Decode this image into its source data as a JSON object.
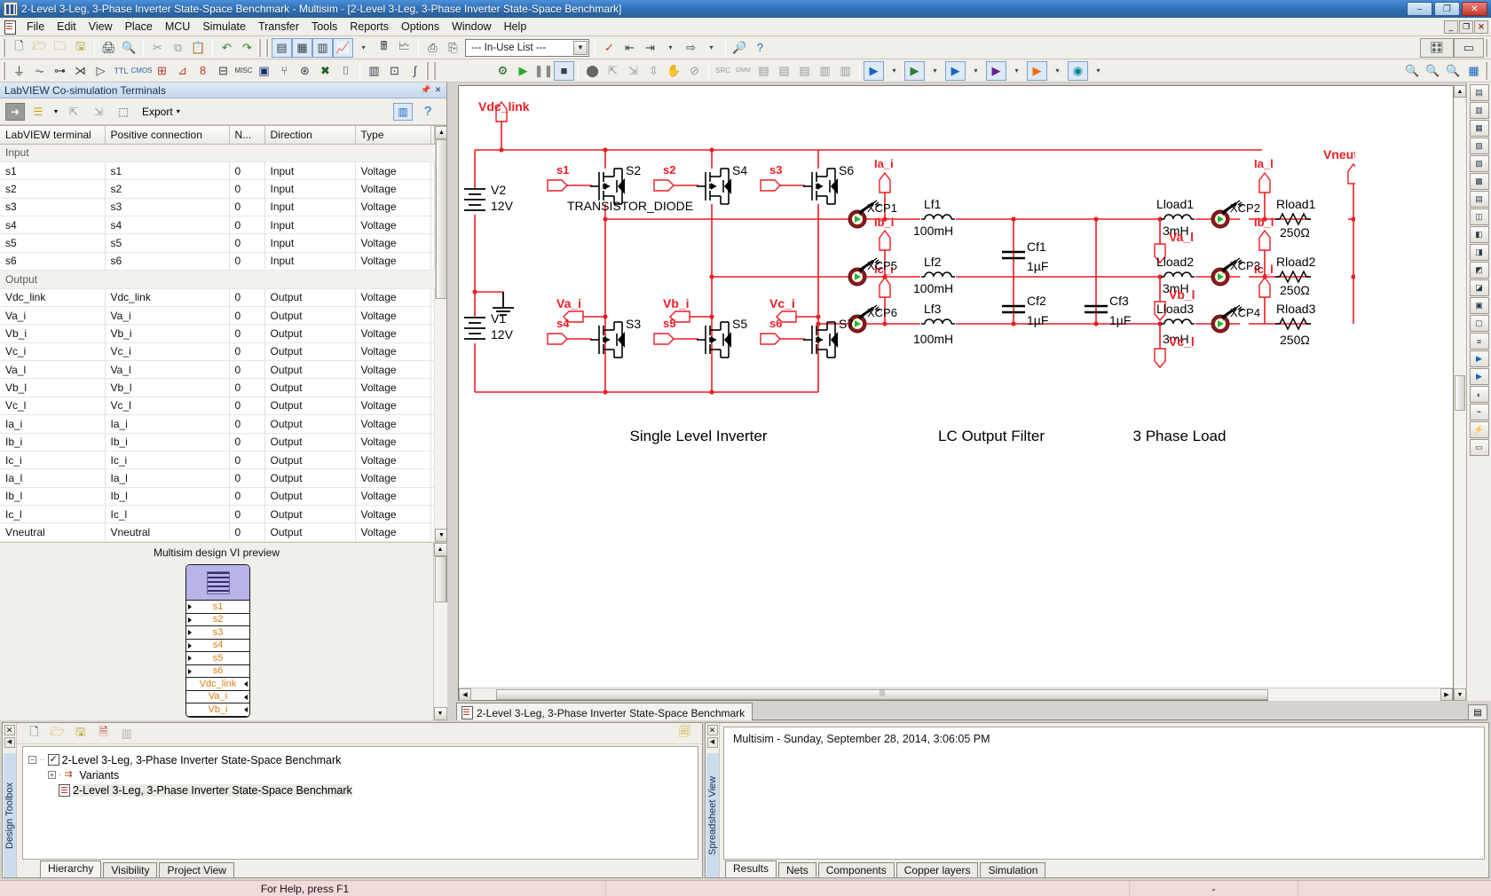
{
  "window": {
    "title": "2-Level 3-Leg, 3-Phase Inverter State-Space Benchmark - Multisim - [2-Level 3-Leg, 3-Phase Inverter State-Space Benchmark]",
    "minimize": "–",
    "maximize": "❐",
    "close": "✕",
    "mdi_minimize": "_",
    "mdi_restore": "❐",
    "mdi_close": "✕"
  },
  "menu": [
    "File",
    "Edit",
    "View",
    "Place",
    "MCU",
    "Simulate",
    "Transfer",
    "Tools",
    "Reports",
    "Options",
    "Window",
    "Help"
  ],
  "toolbar": {
    "in_use_list": "--- In-Use List ---",
    "row1_icons": [
      "new-icon",
      "open-icon",
      "open-design-icon",
      "save-icon",
      "print-icon",
      "print-preview-icon",
      "cut-icon",
      "copy-icon",
      "paste-icon",
      "undo-icon",
      "redo-icon",
      "full-screen-icon",
      "grapher-icon",
      "postprocessor-icon",
      "analysis-icon",
      "netlist-icon",
      "back-annotate-icon",
      "forward-annotate-icon",
      "labview-icon"
    ],
    "row2_icons": [
      "source-icon",
      "basic-icon",
      "diode-icon",
      "transistor-icon",
      "analog-icon",
      "ttl-icon",
      "cmos-icon",
      "misc-digital-icon",
      "mixed-icon",
      "indicator-icon",
      "power-icon",
      "misc-icon",
      "advanced-peripherals-icon",
      "rf-icon",
      "electromechanical-icon",
      "ni-components-icon",
      "connectors-icon",
      "mcu-icon",
      "hierarchical-block-icon",
      "bus-icon",
      "sim-settings-icon",
      "run-icon",
      "pause-icon",
      "stop-icon",
      "probe-icon",
      "place-probe-icon",
      "zoom-in-icon",
      "zoom-out-icon",
      "zoom-area-icon",
      "zoom-fit-icon"
    ]
  },
  "labview_panel": {
    "caption": "LabVIEW Co-simulation Terminals",
    "caption_buttons": [
      "pin-icon",
      "close-icon"
    ],
    "toolbar": {
      "export_label": "Export",
      "icons": [
        "arrow-right-icon",
        "terminal-list-icon",
        "add-input-icon",
        "add-output-icon",
        "select-all-icon",
        "split-view-icon",
        "help-icon"
      ]
    },
    "columns": [
      "LabVIEW terminal",
      "Positive connection",
      "N...",
      "Direction",
      "Type"
    ],
    "groups": [
      {
        "label": "Input",
        "rows": [
          {
            "terminal": "s1",
            "positive": "s1",
            "n": "0",
            "direction": "Input",
            "type": "Voltage"
          },
          {
            "terminal": "s2",
            "positive": "s2",
            "n": "0",
            "direction": "Input",
            "type": "Voltage"
          },
          {
            "terminal": "s3",
            "positive": "s3",
            "n": "0",
            "direction": "Input",
            "type": "Voltage"
          },
          {
            "terminal": "s4",
            "positive": "s4",
            "n": "0",
            "direction": "Input",
            "type": "Voltage"
          },
          {
            "terminal": "s5",
            "positive": "s5",
            "n": "0",
            "direction": "Input",
            "type": "Voltage"
          },
          {
            "terminal": "s6",
            "positive": "s6",
            "n": "0",
            "direction": "Input",
            "type": "Voltage"
          }
        ]
      },
      {
        "label": "Output",
        "rows": [
          {
            "terminal": "Vdc_link",
            "positive": "Vdc_link",
            "n": "0",
            "direction": "Output",
            "type": "Voltage"
          },
          {
            "terminal": "Va_i",
            "positive": "Va_i",
            "n": "0",
            "direction": "Output",
            "type": "Voltage"
          },
          {
            "terminal": "Vb_i",
            "positive": "Vb_i",
            "n": "0",
            "direction": "Output",
            "type": "Voltage"
          },
          {
            "terminal": "Vc_i",
            "positive": "Vc_i",
            "n": "0",
            "direction": "Output",
            "type": "Voltage"
          },
          {
            "terminal": "Va_l",
            "positive": "Va_l",
            "n": "0",
            "direction": "Output",
            "type": "Voltage"
          },
          {
            "terminal": "Vb_l",
            "positive": "Vb_l",
            "n": "0",
            "direction": "Output",
            "type": "Voltage"
          },
          {
            "terminal": "Vc_l",
            "positive": "Vc_l",
            "n": "0",
            "direction": "Output",
            "type": "Voltage"
          },
          {
            "terminal": "Ia_i",
            "positive": "Ia_i",
            "n": "0",
            "direction": "Output",
            "type": "Voltage"
          },
          {
            "terminal": "Ib_i",
            "positive": "Ib_i",
            "n": "0",
            "direction": "Output",
            "type": "Voltage"
          },
          {
            "terminal": "Ic_i",
            "positive": "Ic_i",
            "n": "0",
            "direction": "Output",
            "type": "Voltage"
          },
          {
            "terminal": "Ia_l",
            "positive": "Ia_l",
            "n": "0",
            "direction": "Output",
            "type": "Voltage"
          },
          {
            "terminal": "Ib_l",
            "positive": "Ib_l",
            "n": "0",
            "direction": "Output",
            "type": "Voltage"
          },
          {
            "terminal": "Ic_l",
            "positive": "Ic_l",
            "n": "0",
            "direction": "Output",
            "type": "Voltage"
          },
          {
            "terminal": "Vneutral",
            "positive": "Vneutral",
            "n": "0",
            "direction": "Output",
            "type": "Voltage"
          }
        ]
      }
    ],
    "vi_preview": {
      "title": "Multisim design VI preview",
      "terminals": [
        "s1",
        "s2",
        "s3",
        "s4",
        "s5",
        "s6",
        "Vdc_link",
        "Va_i",
        "Vb_i"
      ]
    }
  },
  "schematic": {
    "tab_label": "2-Level 3-Leg, 3-Phase Inverter State-Space Benchmark",
    "section_labels": [
      "Single Level Inverter",
      "LC Output Filter",
      "3 Phase Load"
    ],
    "sources": [
      {
        "ref": "V2",
        "value": "12V"
      },
      {
        "ref": "V1",
        "value": "12V"
      }
    ],
    "component_note": "TRANSISTOR_DIODE",
    "switches": [
      "S2",
      "S4",
      "S6",
      "S3",
      "S5",
      "S7"
    ],
    "gate_labels": [
      "s1",
      "s2",
      "s3",
      "s4",
      "s5",
      "s6"
    ],
    "probes": [
      "XCP1",
      "XCP5",
      "XCP6",
      "XCP2",
      "XCP3",
      "XCP4"
    ],
    "filter_inductors": [
      {
        "ref": "Lf1",
        "value": "100mH"
      },
      {
        "ref": "Lf2",
        "value": "100mH"
      },
      {
        "ref": "Lf3",
        "value": "100mH"
      }
    ],
    "filter_caps": [
      {
        "ref": "Cf1",
        "value": "1µF"
      },
      {
        "ref": "Cf2",
        "value": "1µF"
      },
      {
        "ref": "Cf3",
        "value": "1µF"
      }
    ],
    "load_inductors": [
      {
        "ref": "Lload1",
        "value": "3mH"
      },
      {
        "ref": "Lload2",
        "value": "3mH"
      },
      {
        "ref": "Lload3",
        "value": "3mH"
      }
    ],
    "load_resistors": [
      {
        "ref": "Rload1",
        "value": "250Ω"
      },
      {
        "ref": "Rload2",
        "value": "250Ω"
      },
      {
        "ref": "Rload3",
        "value": "250Ω"
      }
    ],
    "net_labels": [
      "Vdc_link",
      "Va_i",
      "Vb_i",
      "Vc_i",
      "Ia_i",
      "Ib_i",
      "Ic_i",
      "Ia_l",
      "Ib_l",
      "Ic_l",
      "Va_l",
      "Vb_l",
      "Vc_l",
      "Vneutral"
    ]
  },
  "hierarchy_panel": {
    "toolbar_icons": [
      "new-icon",
      "open-icon",
      "save-icon",
      "close-icon",
      "rename-icon",
      "refresh-icon"
    ],
    "tree": {
      "root": "2-Level 3-Leg, 3-Phase Inverter State-Space Benchmark",
      "variants": "Variants",
      "sheet": "2-Level 3-Leg, 3-Phase Inverter State-Space Benchmark"
    },
    "tabs": [
      "Hierarchy",
      "Visibility",
      "Project View"
    ],
    "active_tab": "Hierarchy",
    "side_label": "Design Toolbox"
  },
  "spreadsheet_panel": {
    "side_label": "Spreadsheet View",
    "log_line": "Multisim  -  Sunday, September 28, 2014, 3:06:05 PM",
    "tabs": [
      "Results",
      "Nets",
      "Components",
      "Copper layers",
      "Simulation"
    ],
    "active_tab": "Results"
  },
  "statusbar": {
    "message": "For Help, press F1",
    "field2": "",
    "field3": "-",
    "field4": ""
  },
  "colors": {
    "wire_red": "#ED1C24",
    "label_red": "#ED1C24",
    "component_black": "#000000",
    "title_blue": "#2a6099",
    "probe_dark_red": "#8B1A1A",
    "probe_green": "#22BB22",
    "vi_terminal_orange": "#E07B10"
  }
}
